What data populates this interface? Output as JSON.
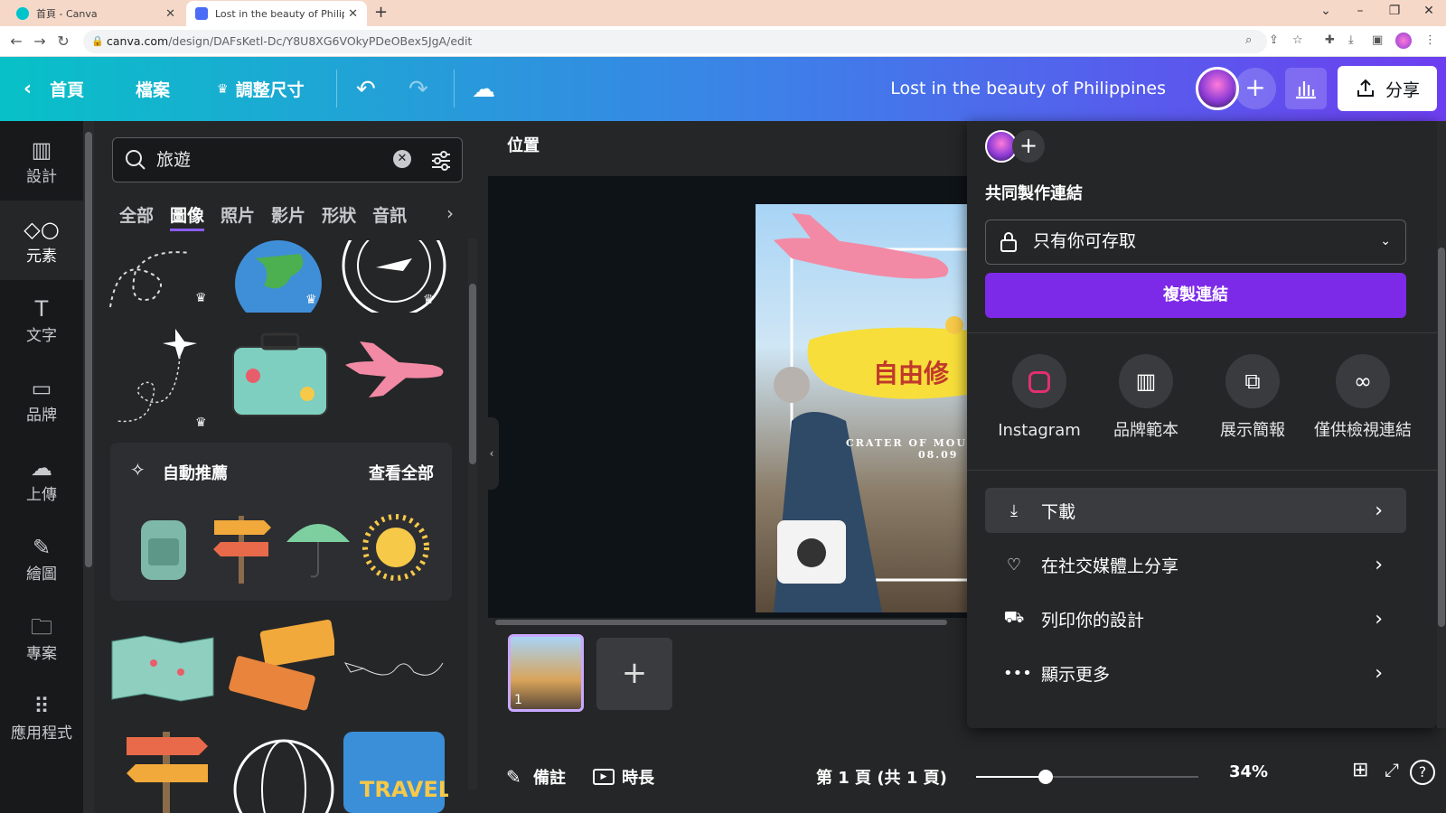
{
  "browser": {
    "tabs": [
      {
        "title": "首頁 - Canva",
        "active": false
      },
      {
        "title": "Lost in the beauty of Philippine",
        "active": true
      }
    ],
    "new_tab": "+",
    "url_host": "canva.com",
    "url_path": "/design/DAFsKetl-Dc/Y8U8XG6VOkyPDeOBex5JgA/edit"
  },
  "topbar": {
    "home": "首頁",
    "file": "檔案",
    "resize": "調整尺寸",
    "title": "Lost in the beauty of Philippines",
    "share": "分享"
  },
  "leftnav": [
    {
      "label": "設計",
      "icon": "design-icon",
      "active": false
    },
    {
      "label": "元素",
      "icon": "elements-icon",
      "active": true
    },
    {
      "label": "文字",
      "icon": "text-icon",
      "active": false
    },
    {
      "label": "品牌",
      "icon": "brand-icon",
      "active": false
    },
    {
      "label": "上傳",
      "icon": "upload-icon",
      "active": false
    },
    {
      "label": "繪圖",
      "icon": "draw-icon",
      "active": false
    },
    {
      "label": "專案",
      "icon": "folder-icon",
      "active": false
    },
    {
      "label": "應用程式",
      "icon": "apps-icon",
      "active": false
    }
  ],
  "panel": {
    "search_value": "旅遊",
    "categories": [
      "全部",
      "圖像",
      "照片",
      "影片",
      "形狀",
      "音訊"
    ],
    "active_category": "圖像",
    "recommend_title": "自動推薦",
    "see_all": "查看全部"
  },
  "stage": {
    "position_label": "位置",
    "design_text_main": "自由修",
    "design_text_sub": "CRATER OF MOU",
    "design_text_date": "08.09",
    "page_number": "1",
    "notes": "備註",
    "duration": "時長",
    "page_info": "第 1 頁 (共 1 頁)",
    "zoom": "34%",
    "zoom_level": 0.34
  },
  "share_panel": {
    "collab_heading": "共同製作連結",
    "access_label": "只有你可存取",
    "copy_link": "複製連結",
    "options": [
      {
        "label": "Instagram",
        "icon": "instagram-icon"
      },
      {
        "label": "品牌範本",
        "icon": "brand-template-icon"
      },
      {
        "label": "展示簡報",
        "icon": "present-icon"
      },
      {
        "label": "僅供檢視連結",
        "icon": "view-link-icon"
      }
    ],
    "rows": [
      {
        "label": "下載",
        "icon": "download-icon"
      },
      {
        "label": "在社交媒體上分享",
        "icon": "social-share-icon"
      },
      {
        "label": "列印你的設計",
        "icon": "print-truck-icon"
      },
      {
        "label": "顯示更多",
        "icon": "more-icon"
      }
    ]
  },
  "colors": {
    "accent_purple": "#7d2ae8",
    "topbar_start": "#08c1c7",
    "topbar_end": "#6d3ef0"
  }
}
